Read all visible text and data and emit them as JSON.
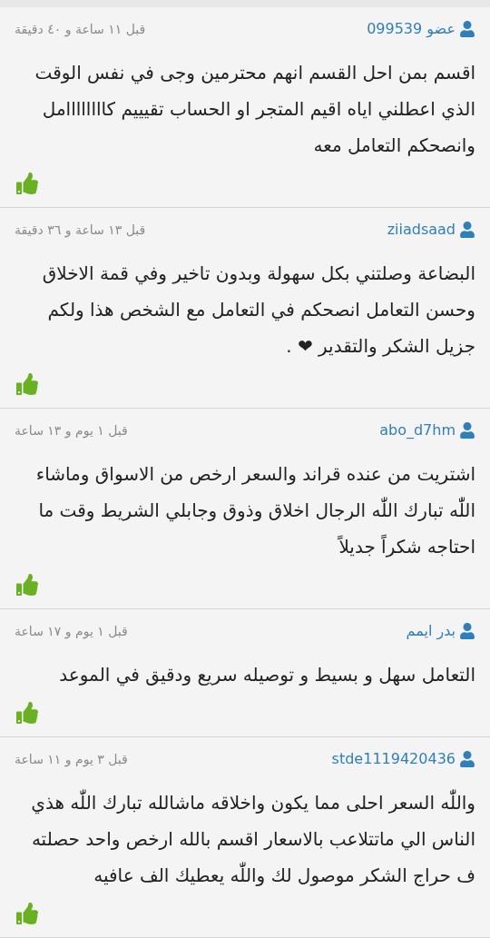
{
  "reviews": [
    {
      "user": "عضو 099539",
      "time": "قبل ١١ ساعة و ٤٠ دقيقة",
      "body": "اقسم بمن احل القسم انهم محترمين وجى في نفس الوقت الذي اعطلني اياه اقيم المتجر او الحساب تقيييم كاااااااامل وانصحكم التعامل معه"
    },
    {
      "user": "ziiadsaad",
      "time": "قبل ١٣ ساعة و ٣٦ دقيقة",
      "body": "البضاعة وصلتني بكل سهولة وبدون تاخير وفي قمة الاخلاق وحسن التعامل انصحكم في التعامل مع الشخص هذا ولكم جزيل الشكر والتقدير ❤ ."
    },
    {
      "user": "abo_d7hm",
      "time": "قبل ١ يوم و ١٣ ساعة",
      "body": "اشتريت من عنده قراند والسعر ارخص من الاسواق وماشاء اللّٰه تبارك اللّٰه  الرجال اخلاق وذوق وجابلي الشريط وقت ما احتاجه شكراً جديلاً"
    },
    {
      "user": "بدر ايمم",
      "time": "قبل ١ يوم و ١٧ ساعة",
      "body": "التعامل سهل و بسيط و توصيله سريع ودقيق في الموعد"
    },
    {
      "user": "stde1119420436",
      "time": "قبل ٣ يوم و ١١ ساعة",
      "body": "واللّٰه السعر احلى مما يكون واخلاقه ماشالله تبارك اللّٰه هذي الناس الي ماتتلاعب بالاسعار اقسم بالله ارخص واحد حصلته ف حراج الشكر موصول لك واللّٰه يعطيك الف عافيه"
    }
  ]
}
